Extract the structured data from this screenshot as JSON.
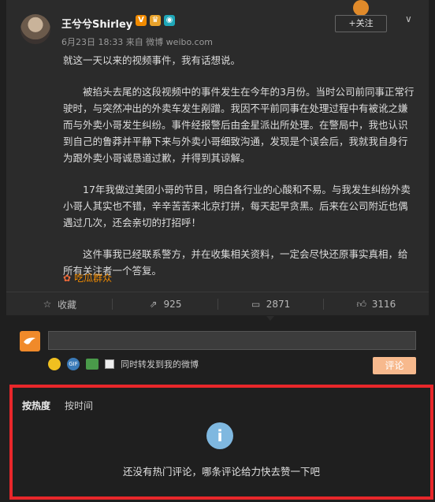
{
  "post": {
    "author": "王兮兮Shirley",
    "badge_v": "V",
    "meta": "6月23日 18:33 来自 微博 weibo.com",
    "follow_label": "+关注",
    "paragraphs": [
      "就这一天以来的视频事件，我有话想说。",
      "被掐头去尾的这段视频中的事件发生在今年的3月份。当时公司前同事正常行驶时，与突然冲出的外卖车发生剐蹭。我因不平前同事在处理过程中有被讹之嫌而与外卖小哥发生纠纷。事件经报警后由金星派出所处理。在警局中，我也认识到自己的鲁莽并平静下来与外卖小哥细致沟通，发现是个误会后，我就我自身行为跟外卖小哥诚恳道过歉，并得到其谅解。",
      "17年我做过美团小哥的节目，明白各行业的心酸和不易。与我发生纠纷外卖小哥人其实也不错，辛辛苦苦来北京打拼，每天起早贪黑。后来在公司附近也偶遇过几次，还会亲切的打招呼！",
      "这件事我已经联系警方，并在收集相关资料，一定会尽快还原事实真相，给所有关注者一个答复。"
    ],
    "tag": "吃瓜群众"
  },
  "actions": {
    "favorite": "收藏",
    "repost": "925",
    "comment": "2871",
    "like": "3116"
  },
  "compose": {
    "repost_label": "同时转发到我的微博",
    "submit_label": "评论",
    "gif_label": "GIF"
  },
  "comments": {
    "sort_hot": "按热度",
    "sort_time": "按时间",
    "empty_message": "还没有热门评论，哪条评论给力快去赞一下吧"
  },
  "colors": {
    "accent": "#f08a00",
    "highlight_border": "#e8272a"
  }
}
